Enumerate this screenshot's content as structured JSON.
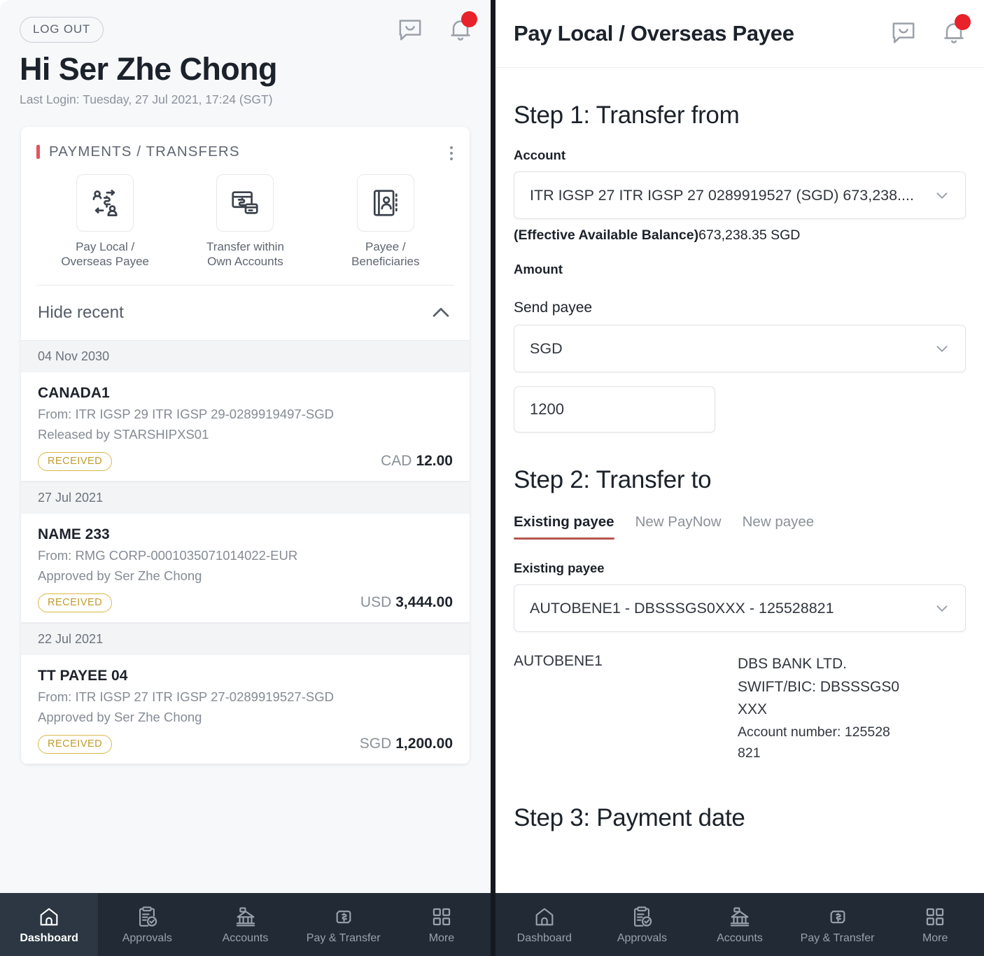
{
  "left": {
    "logout_label": "LOG OUT",
    "greeting": "Hi Ser Zhe Chong",
    "last_login": "Last Login: Tuesday, 27 Jul 2021, 17:24 (SGT)",
    "header_icons": [
      "chat-icon",
      "bell-icon"
    ],
    "card": {
      "title": "PAYMENTS / TRANSFERS",
      "quick_actions": [
        {
          "label": "Pay Local / Overseas Payee",
          "icon": "pay-payee-icon"
        },
        {
          "label": "Transfer within Own Accounts",
          "icon": "card-transfer-icon"
        },
        {
          "label": "Payee / Beneficiaries",
          "icon": "address-book-icon"
        }
      ],
      "hide_recent_label": "Hide recent",
      "groups": [
        {
          "date": "04 Nov 2030",
          "txns": [
            {
              "name": "CANADA1",
              "from": "From: ITR IGSP 29 ITR IGSP 29-0289919497-SGD",
              "actor": "Released by STARSHIPXS01",
              "status": "RECEIVED",
              "currency": "CAD",
              "amount": "12.00"
            }
          ]
        },
        {
          "date": "27 Jul 2021",
          "txns": [
            {
              "name": "NAME 233",
              "from": "From: RMG CORP-0001035071014022-EUR",
              "actor": "Approved by Ser Zhe Chong",
              "status": "RECEIVED",
              "currency": "USD",
              "amount": "3,444.00"
            }
          ]
        },
        {
          "date": "22 Jul 2021",
          "txns": [
            {
              "name": "TT PAYEE 04",
              "from": "From: ITR IGSP 27 ITR IGSP 27-0289919527-SGD",
              "actor": "Approved by Ser Zhe Chong",
              "status": "RECEIVED",
              "currency": "SGD",
              "amount": "1,200.00"
            }
          ]
        }
      ]
    },
    "bottom_nav": [
      {
        "label": "Dashboard",
        "icon": "home-icon",
        "active": true
      },
      {
        "label": "Approvals",
        "icon": "clipboard-check-icon",
        "active": false
      },
      {
        "label": "Accounts",
        "icon": "bank-icon",
        "active": false
      },
      {
        "label": "Pay & Transfer",
        "icon": "transfer-dollar-icon",
        "active": false
      },
      {
        "label": "More",
        "icon": "grid-icon",
        "active": false
      }
    ]
  },
  "right": {
    "title": "Pay Local / Overseas Payee",
    "header_icons": [
      "chat-icon",
      "bell-icon"
    ],
    "step1": {
      "heading": "Step 1: Transfer from",
      "account_label": "Account",
      "account_value": "ITR IGSP 27 ITR IGSP 27 0289919527 (SGD) 673,238....",
      "balance_prefix": "(Effective Available Balance)",
      "balance_value": "673,238.35 SGD",
      "amount_label": "Amount",
      "send_payee_label": "Send payee",
      "currency_value": "SGD",
      "amount_value": "1200"
    },
    "step2": {
      "heading": "Step 2: Transfer to",
      "tabs": [
        {
          "label": "Existing payee",
          "active": true
        },
        {
          "label": "New PayNow",
          "active": false
        },
        {
          "label": "New payee",
          "active": false
        }
      ],
      "existing_payee_label": "Existing payee",
      "existing_payee_value": "AUTOBENE1 - DBSSSGS0XXX - 125528821",
      "detail_name": "AUTOBENE1",
      "detail_bank": "DBS BANK LTD.",
      "detail_swift": "SWIFT/BIC: DBSSSGS0",
      "detail_swift2": "XXX",
      "detail_account": "Account number: 125528",
      "detail_account2": "821"
    },
    "step3": {
      "heading": "Step 3: Payment date"
    },
    "bottom_nav": [
      {
        "label": "Dashboard",
        "icon": "home-icon",
        "active": false
      },
      {
        "label": "Approvals",
        "icon": "clipboard-check-icon",
        "active": false
      },
      {
        "label": "Accounts",
        "icon": "bank-icon",
        "active": false
      },
      {
        "label": "Pay & Transfer",
        "icon": "transfer-dollar-icon",
        "active": false
      },
      {
        "label": "More",
        "icon": "grid-icon",
        "active": false
      }
    ]
  },
  "colors": {
    "accent_red": "#e8535a",
    "badge_red": "#e8212a",
    "chip_gold": "#c09a2b",
    "nav_dark": "#212a35",
    "tab_underline": "#b5574f"
  }
}
